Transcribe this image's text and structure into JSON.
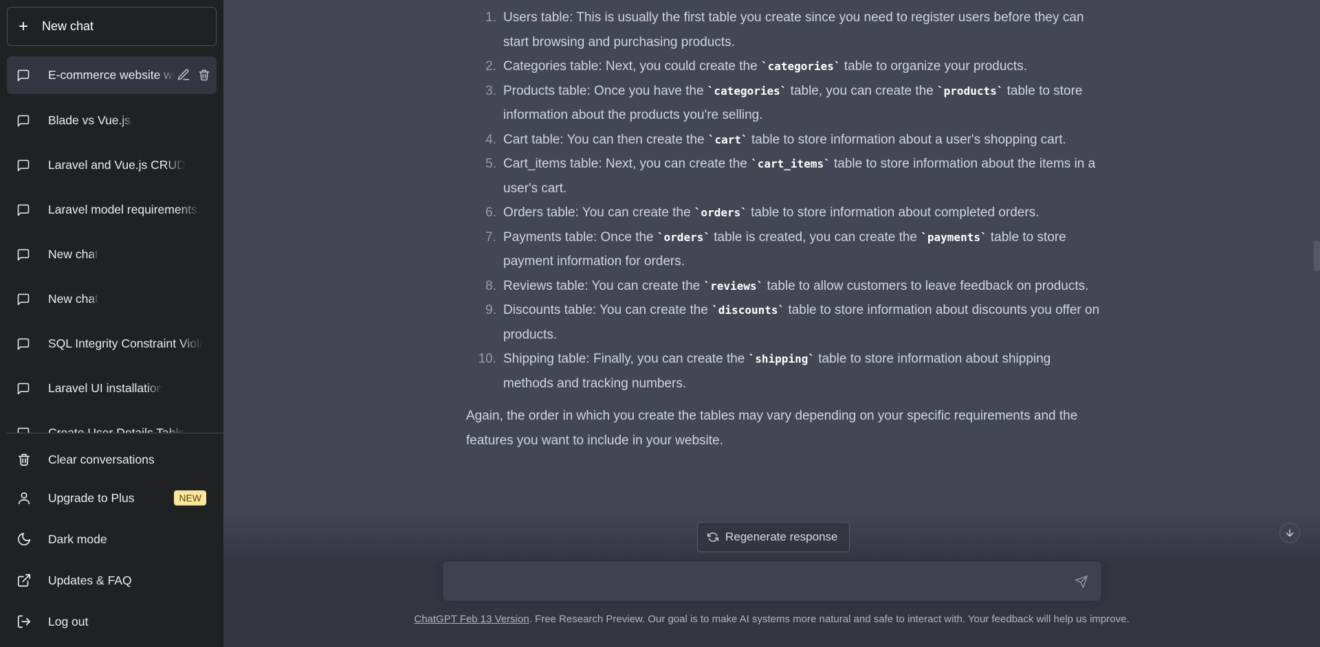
{
  "sidebar": {
    "new_chat_label": "New chat",
    "history": [
      {
        "label": "E-commerce website wi",
        "active": true
      },
      {
        "label": "Blade vs Vue.js."
      },
      {
        "label": "Laravel and Vue.js CRUD"
      },
      {
        "label": "Laravel model requirements."
      },
      {
        "label": "New chat"
      },
      {
        "label": "New chat"
      },
      {
        "label": "SQL Integrity Constraint Violati"
      },
      {
        "label": "Laravel UI installation"
      },
      {
        "label": "Create User Details Table"
      }
    ],
    "bottom": {
      "clear": "Clear conversations",
      "upgrade": "Upgrade to Plus",
      "upgrade_badge": "NEW",
      "dark_mode": "Dark mode",
      "updates": "Updates & FAQ",
      "logout": "Log out"
    }
  },
  "message": {
    "steps": [
      {
        "num": "1.",
        "parts": [
          "Users table: This is usually the first table you create since you need to register users before they can start browsing and purchasing products."
        ]
      },
      {
        "num": "2.",
        "parts": [
          "Categories table: Next, you could create the ",
          {
            "code": "`categories`"
          },
          " table to organize your products."
        ]
      },
      {
        "num": "3.",
        "parts": [
          "Products table: Once you have the ",
          {
            "code": "`categories`"
          },
          " table, you can create the ",
          {
            "code": "`products`"
          },
          " table to store information about the products you're selling."
        ]
      },
      {
        "num": "4.",
        "parts": [
          "Cart table: You can then create the ",
          {
            "code": "`cart`"
          },
          " table to store information about a user's shopping cart."
        ]
      },
      {
        "num": "5.",
        "parts": [
          "Cart_items table: Next, you can create the ",
          {
            "code": "`cart_items`"
          },
          " table to store information about the items in a user's cart."
        ]
      },
      {
        "num": "6.",
        "parts": [
          "Orders table: You can create the ",
          {
            "code": "`orders`"
          },
          " table to store information about completed orders."
        ]
      },
      {
        "num": "7.",
        "parts": [
          "Payments table: Once the ",
          {
            "code": "`orders`"
          },
          " table is created, you can create the ",
          {
            "code": "`payments`"
          },
          " table to store payment information for orders."
        ]
      },
      {
        "num": "8.",
        "parts": [
          "Reviews table: You can create the ",
          {
            "code": "`reviews`"
          },
          " table to allow customers to leave feedback on products."
        ]
      },
      {
        "num": "9.",
        "parts": [
          "Discounts table: You can create the ",
          {
            "code": "`discounts`"
          },
          " table to store information about discounts you offer on products."
        ]
      },
      {
        "num": "10.",
        "parts": [
          "Shipping table: Finally, you can create the ",
          {
            "code": "`shipping`"
          },
          " table to store information about shipping methods and tracking numbers."
        ]
      }
    ],
    "closing": "Again, the order in which you create the tables may vary depending on your specific requirements and the features you want to include in your website."
  },
  "regenerate_label": "Regenerate response",
  "input": {
    "placeholder": ""
  },
  "footer": {
    "link": "ChatGPT Feb 13 Version",
    "text": ". Free Research Preview. Our goal is to make AI systems more natural and safe to interact with. Your feedback will help us improve."
  },
  "icons": {
    "new_chat": "plus-icon",
    "history": "chat-bubble-icon",
    "edit": "pencil-icon",
    "delete": "trash-icon",
    "clear": "trash-icon",
    "upgrade": "user-icon",
    "dark_mode": "moon-icon",
    "updates": "external-link-icon",
    "logout": "logout-icon",
    "regenerate": "refresh-icon",
    "send": "send-icon",
    "scroll_down": "arrow-down-icon"
  },
  "colors": {
    "sidebar_bg": "#202123",
    "main_bg": "#444654",
    "input_bg": "#40414f",
    "badge_bg": "#fae69e"
  }
}
